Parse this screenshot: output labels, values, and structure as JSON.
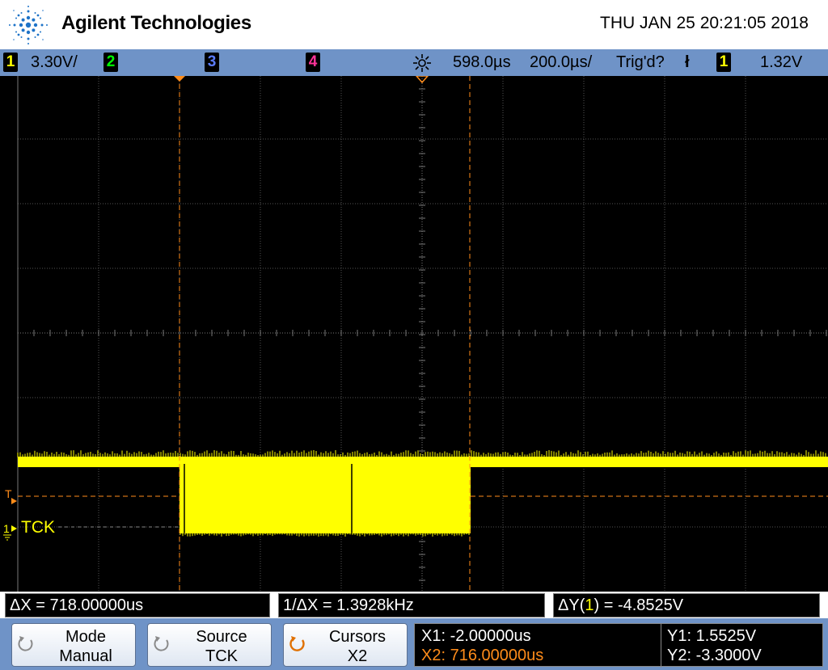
{
  "header": {
    "brand": "Agilent Technologies",
    "datetime": "THU JAN 25 20:21:05 2018"
  },
  "status_bar": {
    "ch1_label": "1",
    "ch1_scale": "3.30V/",
    "ch2_label": "2",
    "ch3_label": "3",
    "ch4_label": "4",
    "delay": "598.0µs",
    "timebase": "200.0µs/",
    "trigger_status": "Trig'd?",
    "trigger_slope_glyph": "ł",
    "trigger_source": "1",
    "trigger_level": "1.32V"
  },
  "waveform": {
    "channel_label": "TCK",
    "trigger_marker": "T",
    "ground_marker": "1"
  },
  "measurements": {
    "delta_x": "ΔX = 718.00000us",
    "inv_delta_x": "1/ΔX = 1.3928kHz",
    "delta_y_prefix": "ΔY(",
    "delta_y_channel": "1",
    "delta_y_suffix": ") = -4.8525V"
  },
  "softkeys": {
    "mode_label": "Mode",
    "mode_value": "Manual",
    "source_label": "Source",
    "source_value": "TCK",
    "cursors_label": "Cursors",
    "cursors_value": "X2"
  },
  "cursor_readout": {
    "x1": "X1: -2.00000us",
    "x2": "X2: 716.00000us",
    "y1": "Y1: 1.5525V",
    "y2": "Y2: -3.3000V"
  },
  "colors": {
    "channel1": "#ffff00",
    "channel2": "#00ff00",
    "channel3": "#5b7dff",
    "channel4": "#ff3399",
    "cursor": "#ff8c1a",
    "status_bar": "#6f93c7"
  }
}
